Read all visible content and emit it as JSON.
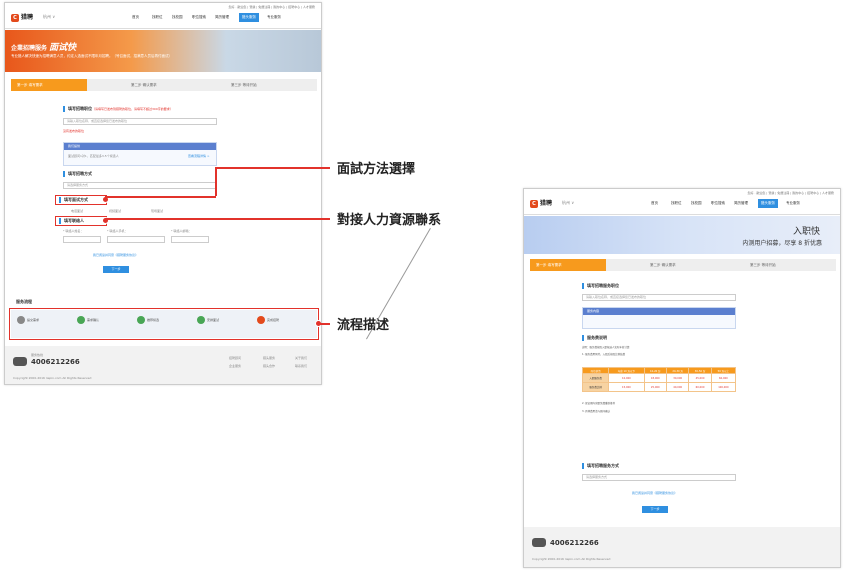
{
  "annotations": {
    "method": "面試方法選擇",
    "hr": "對接人力資源聯系",
    "process": "流程描述"
  },
  "left": {
    "util": "您好 · 歡迎您 | 登錄 | 免費注冊 | 我的中心 | 招聘中心 | 人才服務",
    "logo": "猎聘",
    "location": "杭州 ∨",
    "nav": [
      "首页",
      "找职位",
      "找校园",
      "职位搜索",
      "简历管理",
      "猎头服务",
      "专业服务"
    ],
    "banner_title": "企業招聘服务",
    "banner_big": "面试快",
    "banner_sub": "专业猎人解决快速为招聘满意人员，约定入选面试不限年月招聘。（号召面试，招满意人员后再付面试）",
    "steps": [
      "第一步  填写需求",
      "第二步  确认需求",
      "第三步  等待开始"
    ],
    "section1": "填写招聘职位",
    "section1_note": "（请填写已发布到猎聘的职位，请填写不超过300字的要求）",
    "input1_ph": "请输入职位名称，或直接选择您已发布的职位",
    "link1": "没有发布的职位",
    "box_title": "我们提供",
    "box_text": "面试顾问1对1，匹配最多3-5个候选人",
    "box_link": "查看流程详情 >",
    "section2": "填写招聘方式",
    "select2": "请选择服务方式",
    "section3": "填写面试方式",
    "radios": [
      "电话面试",
      "视频面试",
      "现场面试"
    ],
    "section4": "填写联络人",
    "contact_labels": [
      "* 联络人姓名：",
      "* 联络人手机：",
      "* 联络人邮箱："
    ],
    "agree": "我已阅读并同意《猎聘服务协议》",
    "next": "下一步",
    "flow_title": "服务流程",
    "flow_items": [
      "提交需求",
      "需求确认",
      "推荐候选",
      "安排面试",
      "完成招聘"
    ],
    "hotline_label": "服务热线",
    "hotline": "4006212266",
    "footer_links": [
      "招聘顾问",
      "猎头服务",
      "关于我们",
      "企业服务",
      "猎头合作",
      "联系我们"
    ],
    "copyright": "Copyright 2000-2016 liepin.com All Rights Reserved"
  },
  "right": {
    "banner1": "入职快",
    "banner2": "内测用户招募，尽享 8 折优惠",
    "section1": "填写招聘服务职位",
    "input1_ph": "请输入职位名称，或直接选择您已发布的职位",
    "box_title": "服务内容",
    "section2": "服务费说明",
    "table_head": [
      "岗位薪资",
      "年薪 10 万以下",
      "10-20 万",
      "20-30 万",
      "30-50 万",
      "50 万以上"
    ],
    "table_rows": [
      [
        "入职服务费",
        "10,000",
        "18,000",
        "30,000",
        "45,000",
        "60,000"
      ],
      [
        "服务费比例",
        "15,000",
        "25,000",
        "40,000",
        "60,000",
        "100,000"
      ]
    ],
    "notes": [
      "说明：服务费按照入职候选人实际年薪计算",
      "1. 服务费用预付，入职后按照比例结算",
      "2. 保证期内离职免费重新推荐",
      "3. 具体费用请与顾问确认"
    ],
    "section3": "填写招聘服务方式",
    "select3": "请选择服务方式",
    "agree": "我已阅读并同意《猎聘服务协议》",
    "next": "下一步",
    "hotline": "4006212266"
  }
}
